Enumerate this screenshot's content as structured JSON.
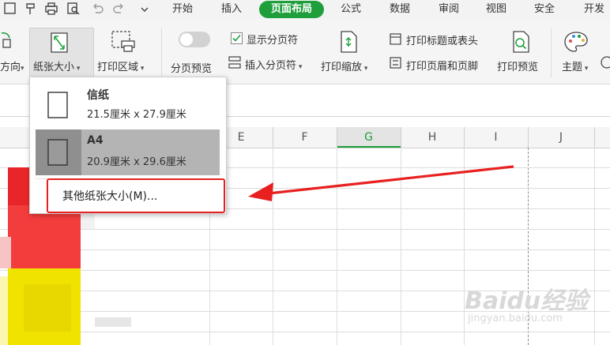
{
  "menu_tabs": [
    "开始",
    "插入",
    "页面布局",
    "公式",
    "数据",
    "审阅",
    "视图",
    "安全",
    "开发"
  ],
  "active_tab": "页面布局",
  "ribbon": {
    "orientation_label": "方向",
    "paper_size_label": "纸张大小",
    "print_area_label": "打印区域",
    "page_break_preview_label": "分页预览",
    "show_page_breaks_label": "显示分页符",
    "insert_page_break_label": "插入分页符",
    "print_scale_label": "打印缩放",
    "print_titles_label": "打印标题或表头",
    "print_header_footer_label": "打印页眉和页脚",
    "print_preview_label": "打印预览",
    "theme_label": "主题"
  },
  "paper_menu": {
    "options": [
      {
        "name": "信纸",
        "size": "21.5厘米 x 27.9厘米"
      },
      {
        "name": "A4",
        "size": "20.9厘米 x 29.6厘米"
      }
    ],
    "selected": "A4",
    "more_label": "其他纸张大小(M)..."
  },
  "columns": [
    "E",
    "F",
    "G",
    "H",
    "I",
    "J"
  ],
  "active_column": "G",
  "watermark": {
    "logo": "Baidu经验",
    "url": "jingyan.baidu.com"
  },
  "colors": {
    "accent": "#1e9f3c",
    "highlight_red": "#e82020",
    "selected_option": "#b4b4b4"
  }
}
